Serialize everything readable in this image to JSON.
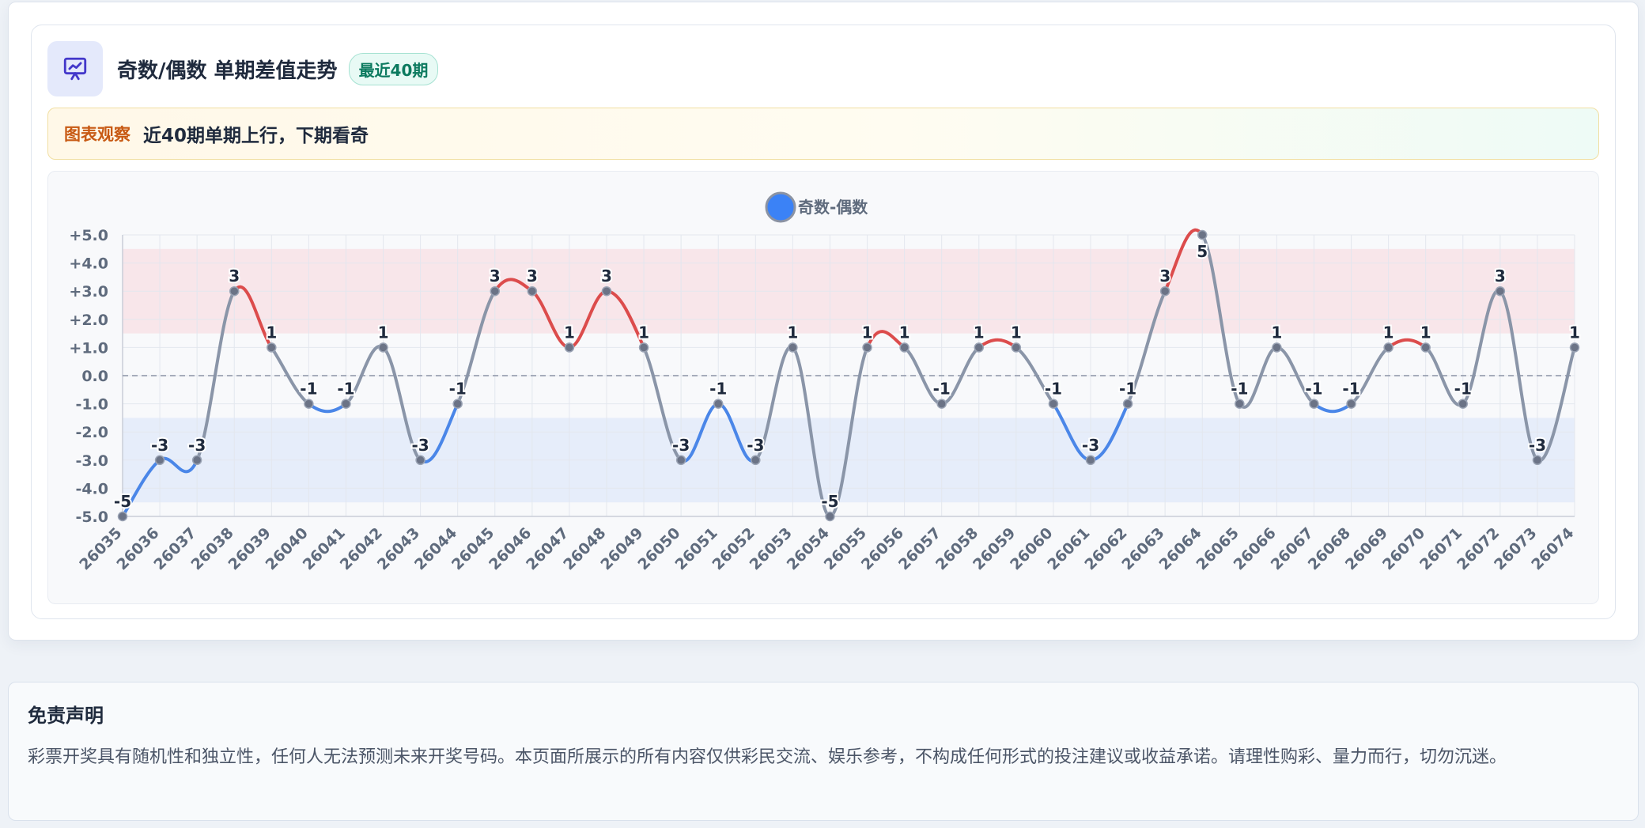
{
  "header": {
    "title": "奇数/偶数 单期差值走势",
    "badge": "最近40期",
    "icon": "presentation-chart-icon",
    "accent_color": "#4338ca"
  },
  "notice": {
    "tag": "图表观察",
    "text": "近40期单期上行，下期看奇"
  },
  "chart_data": {
    "type": "line",
    "legend": {
      "label": "奇数-偶数",
      "placement": "top-center",
      "color": "#3b82f6"
    },
    "categories": [
      "26035",
      "26036",
      "26037",
      "26038",
      "26039",
      "26040",
      "26041",
      "26042",
      "26043",
      "26044",
      "26045",
      "26046",
      "26047",
      "26048",
      "26049",
      "26050",
      "26051",
      "26052",
      "26053",
      "26054",
      "26055",
      "26056",
      "26057",
      "26058",
      "26059",
      "26060",
      "26061",
      "26062",
      "26063",
      "26064",
      "26065",
      "26066",
      "26067",
      "26068",
      "26069",
      "26070",
      "26071",
      "26072",
      "26073",
      "26074"
    ],
    "series": [
      {
        "name": "奇数-偶数",
        "values": [
          -5,
          -3,
          -3,
          3,
          1,
          -1,
          -1,
          1,
          -3,
          -1,
          3,
          3,
          1,
          3,
          1,
          -3,
          -1,
          -3,
          1,
          -5,
          1,
          1,
          -1,
          1,
          1,
          -1,
          -3,
          -1,
          3,
          5,
          -1,
          1,
          -1,
          -1,
          1,
          1,
          -1,
          3,
          -3,
          1
        ]
      }
    ],
    "ylim": [
      -5,
      5
    ],
    "y_ticks": [
      5,
      4,
      3,
      2,
      1,
      0,
      -1,
      -2,
      -3,
      -4,
      -5
    ],
    "y_tick_labels": [
      "+5.0",
      "+4.0",
      "+3.0",
      "+2.0",
      "+1.0",
      "0.0",
      "-1.0",
      "-2.0",
      "-3.0",
      "-4.0",
      "-5.0"
    ],
    "bands": [
      {
        "from": 1.5,
        "to": 4.5,
        "color": "#f8e6ea"
      },
      {
        "from": -4.5,
        "to": -1.5,
        "color": "#e6edfa"
      }
    ],
    "reference_line": 0,
    "grid": true,
    "colors": {
      "up": "#dc4c4c",
      "down": "#4a86e8",
      "neutral": "#8a95a8",
      "point": "#6b7386"
    }
  },
  "disclaimer": {
    "title": "免责声明",
    "text": "彩票开奖具有随机性和独立性，任何人无法预测未来开奖号码。本页面所展示的所有内容仅供彩民交流、娱乐参考，不构成任何形式的投注建议或收益承诺。请理性购彩、量力而行，切勿沉迷。"
  }
}
